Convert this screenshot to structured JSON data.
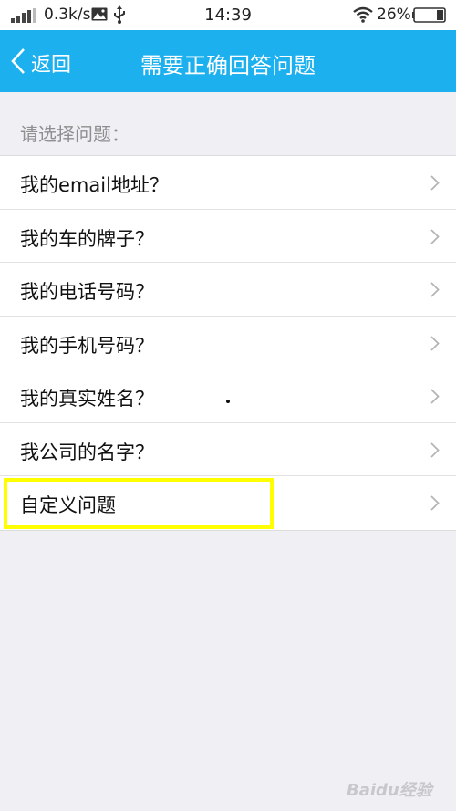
{
  "status_bar": {
    "network_speed": "0.3k/s",
    "time": "14:39",
    "battery": "26%"
  },
  "header": {
    "back_label": "返回",
    "title": "需要正确回答问题"
  },
  "section_label": "请选择问题：",
  "questions": [
    {
      "label": "我的email地址？"
    },
    {
      "label": "我的车的牌子？"
    },
    {
      "label": "我的电话号码？"
    },
    {
      "label": "我的手机号码？"
    },
    {
      "label": "我的真实姓名？"
    },
    {
      "label": "我公司的名字？"
    },
    {
      "label": "自定义问题"
    }
  ],
  "watermark": "Baidu经验",
  "colors": {
    "header_bg": "#1cb0ef",
    "page_bg": "#efeff4",
    "highlight": "#ffff00"
  }
}
